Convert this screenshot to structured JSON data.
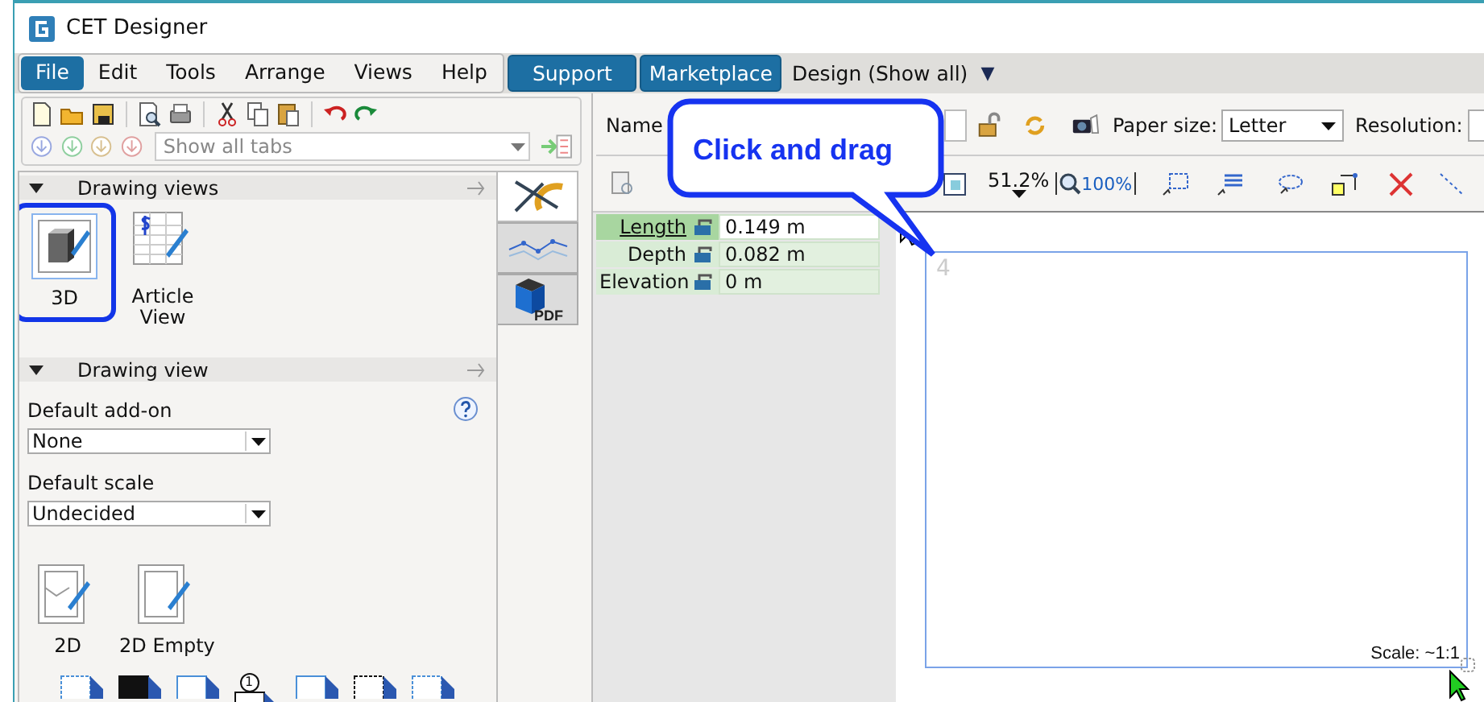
{
  "window": {
    "title": "CET Designer"
  },
  "menu": [
    {
      "label": "File",
      "selected": true
    },
    {
      "label": "Edit",
      "selected": false
    },
    {
      "label": "Tools",
      "selected": false
    },
    {
      "label": "Arrange",
      "selected": false
    },
    {
      "label": "Views",
      "selected": false
    },
    {
      "label": "Help",
      "selected": false
    }
  ],
  "menu_buttons": [
    "Support",
    "Marketplace"
  ],
  "mode_selector": {
    "label": "Design (Show all)",
    "arrow": "▼"
  },
  "tab_filter": {
    "value": "Show all tabs"
  },
  "palette": {
    "sections": [
      {
        "title": "Drawing views",
        "expanded": true,
        "items": [
          {
            "label": "3D",
            "kind": "cube",
            "selected": true
          },
          {
            "label": "Article View",
            "kind": "article",
            "selected": false
          }
        ]
      },
      {
        "title": "Drawing view",
        "expanded": true,
        "fields": [
          {
            "label": "Default add-on",
            "value": "None"
          },
          {
            "label": "Default scale",
            "value": "Undecided"
          }
        ],
        "items": [
          {
            "label": "2D",
            "kind": "plan",
            "selected": false
          },
          {
            "label": "2D Empty",
            "kind": "blank",
            "selected": false
          }
        ]
      }
    ],
    "badge": "1"
  },
  "side_tabs": [
    {
      "kind": "tools",
      "selected": true
    },
    {
      "kind": "line",
      "selected": false
    },
    {
      "kind": "pdf",
      "label": "PDF",
      "selected": false
    }
  ],
  "toolbar": {
    "name_label": "Name",
    "paper_size_label": "Paper size:",
    "paper_size": "Letter",
    "resolution_label": "Resolution:",
    "zoom": "51.2%",
    "zoom_reset": "100%"
  },
  "properties": [
    {
      "label": "Length",
      "value": "0.149 m",
      "selected": true
    },
    {
      "label": "Depth",
      "value": "0.082 m",
      "selected": false
    },
    {
      "label": "Elevation",
      "value": "0 m",
      "selected": false
    }
  ],
  "paper": {
    "page_number": "4",
    "scale": "Scale: ~1:1"
  },
  "callout": {
    "text": "Click and drag"
  }
}
